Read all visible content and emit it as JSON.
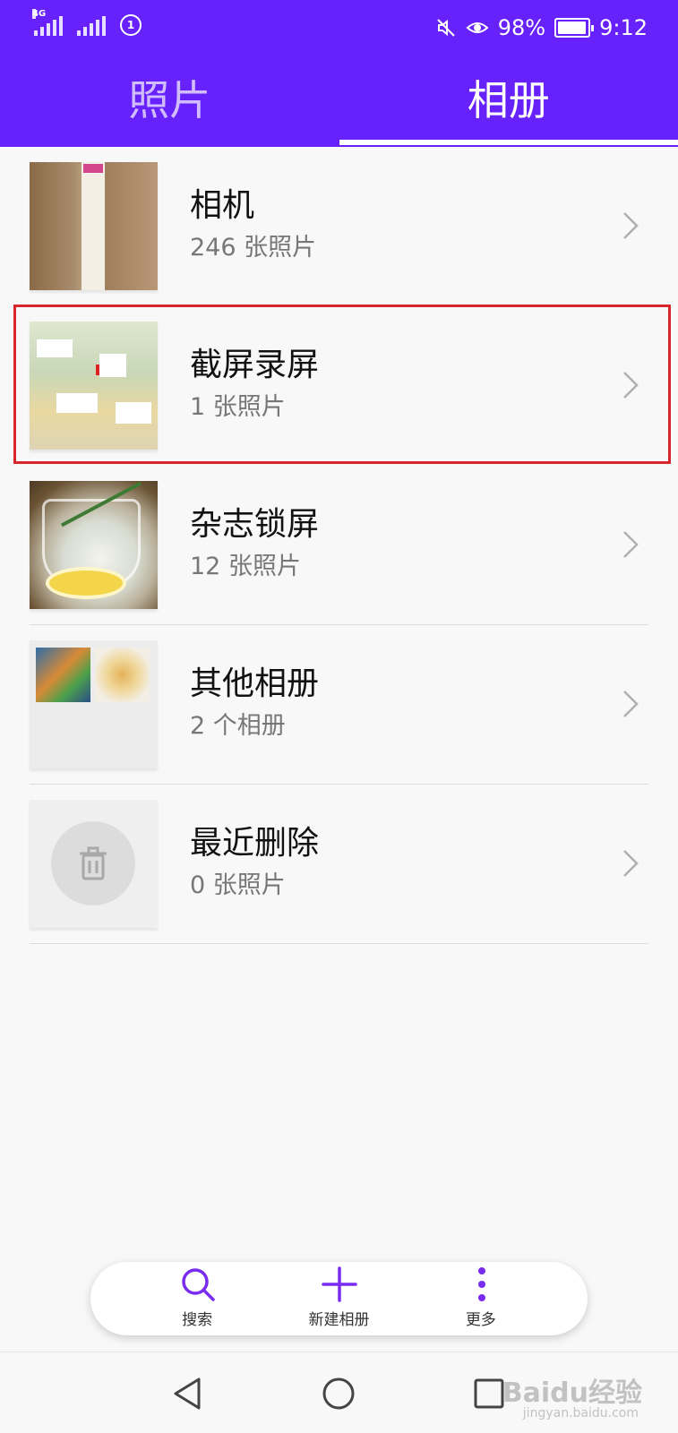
{
  "status_bar": {
    "network_left": "4G",
    "battery_percent": "98%",
    "battery_level": 0.98,
    "time": "9:12"
  },
  "tabs": [
    {
      "label": "照片",
      "active": false
    },
    {
      "label": "相册",
      "active": true
    }
  ],
  "albums": [
    {
      "title": "相机",
      "count": "246 张照片"
    },
    {
      "title": "截屏录屏",
      "count": "1 张照片",
      "highlighted": true
    },
    {
      "title": "杂志锁屏",
      "count": "12 张照片"
    },
    {
      "title": "其他相册",
      "count": "2 个相册"
    },
    {
      "title": "最近删除",
      "count": "0 张照片"
    }
  ],
  "actions": {
    "search": "搜索",
    "new_album": "新建相册",
    "more": "更多"
  },
  "watermark": {
    "main": "Baidu经验",
    "sub": "jingyan.baidu.com"
  },
  "colors": {
    "header": "#6722fb",
    "accent": "#7a2bf0",
    "highlight_border": "#d7272c"
  },
  "icons": {
    "search": "search-icon",
    "add": "plus-icon",
    "more": "more-vertical-icon",
    "back": "back-triangle-icon",
    "home": "home-circle-icon",
    "recents": "recents-square-icon",
    "trash": "trash-icon",
    "chevron": "chevron-right-icon"
  }
}
